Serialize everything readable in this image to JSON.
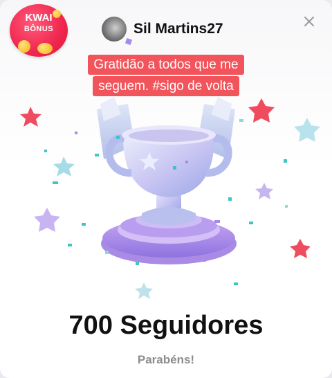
{
  "badge": {
    "line1": "KWAI",
    "line2": "BÔNUS"
  },
  "profile": {
    "username": "Sil Martins27"
  },
  "message": {
    "text": "Gratidão a todos que me seguem. #sigo de volta"
  },
  "achievement": {
    "title": "700 Seguidores",
    "subtitle": "Parabéns!"
  },
  "icons": {
    "close": "close-icon",
    "trophy": "trophy-icon"
  },
  "colors": {
    "message_bg": "#f2545b",
    "badge_bg": "#f0264f",
    "trophy": "#c7c3f2"
  }
}
